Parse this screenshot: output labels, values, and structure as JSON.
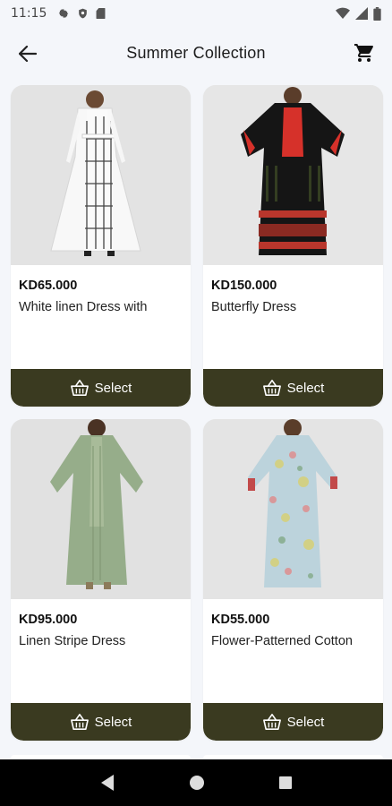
{
  "status_bar": {
    "time": "11:15"
  },
  "app_bar": {
    "title": "Summer Collection"
  },
  "products": [
    {
      "price": "KD65.000",
      "name": "White linen Dress with",
      "button": "Select"
    },
    {
      "price": "KD150.000",
      "name": "Butterfly Dress",
      "button": "Select"
    },
    {
      "price": "KD95.000",
      "name": "Linen Stripe Dress",
      "button": "Select"
    },
    {
      "price": "KD55.000",
      "name": "Flower-Patterned Cotton",
      "button": "Select"
    }
  ],
  "colors": {
    "button_bg": "#3a3a20",
    "page_bg": "#f4f6fa"
  }
}
